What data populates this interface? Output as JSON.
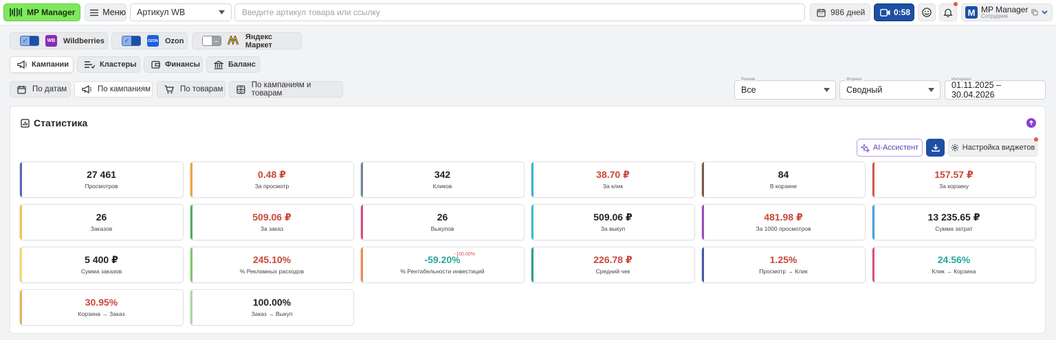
{
  "header": {
    "logo_text": "MP Manager",
    "menu_label": "Меню",
    "article_select": "Артикул WB",
    "search_placeholder": "Введите артикул товара или ссылку",
    "days_label": "986 дней",
    "timer_label": "0:58",
    "user_name": "MP Manager",
    "user_role": "Сотрудник",
    "avatar_letter": "M"
  },
  "marketplaces": [
    {
      "label": "Wildberries",
      "enabled": true,
      "logo": "WB",
      "color": "#8b2bb5"
    },
    {
      "label": "Ozon",
      "enabled": true,
      "logo": "OZON",
      "color": "#1e5fe0"
    },
    {
      "label": "Яндекс Маркет",
      "enabled": false,
      "logo": "YM",
      "color": "#f5c518"
    }
  ],
  "categories": [
    {
      "label": "Кампании",
      "icon": "megaphone-icon",
      "active": true
    },
    {
      "label": "Кластеры",
      "icon": "list-icon",
      "active": false
    },
    {
      "label": "Финансы",
      "icon": "wallet-icon",
      "active": false
    },
    {
      "label": "Баланс",
      "icon": "bank-icon",
      "active": false
    }
  ],
  "views": [
    {
      "label": "По датам",
      "icon": "calendar-icon",
      "active": false
    },
    {
      "label": "По кампаниям",
      "icon": "megaphone-icon",
      "active": true
    },
    {
      "label": "По товарам",
      "icon": "cart-icon",
      "active": false
    },
    {
      "label": "По кампаниям и товарам",
      "icon": "grid-icon",
      "active": false
    }
  ],
  "filters": {
    "mode_label": "Режим",
    "mode_value": "Все",
    "format_label": "Формат",
    "format_value": "Сводный",
    "interval_label": "Интервал",
    "interval_value": "01.11.2025 – 30.04.2026"
  },
  "stats": {
    "title": "Статистика",
    "ai_label": "AI-Ассистент",
    "settings_label": "Настройка виджетов",
    "cards": [
      {
        "value": "27 461",
        "caption": "Просмотров",
        "bar": "#5a67b8",
        "tone": "dark"
      },
      {
        "value": "0.48 ₽",
        "caption": "За просмотр",
        "bar": "#f0a33c",
        "tone": "red"
      },
      {
        "value": "342",
        "caption": "Кликов",
        "bar": "#6f8496",
        "tone": "dark"
      },
      {
        "value": "38.70 ₽",
        "caption": "За клик",
        "bar": "#3ab3d6",
        "tone": "red"
      },
      {
        "value": "84",
        "caption": "В корзине",
        "bar": "#7a5a48",
        "tone": "dark"
      },
      {
        "value": "157.57 ₽",
        "caption": "За корзину",
        "bar": "#d9564e",
        "tone": "red"
      },
      {
        "value": "26",
        "caption": "Заказов",
        "bar": "#f0c84a",
        "tone": "dark"
      },
      {
        "value": "509.06 ₽",
        "caption": "За заказ",
        "bar": "#4fae5c",
        "tone": "red"
      },
      {
        "value": "26",
        "caption": "Выкупов",
        "bar": "#d94a86",
        "tone": "dark"
      },
      {
        "value": "509.06 ₽",
        "caption": "За выкуп",
        "bar": "#3bbfc8",
        "tone": "dark"
      },
      {
        "value": "481.98 ₽",
        "caption": "За 1000 просмотров",
        "bar": "#9b4cc0",
        "tone": "red"
      },
      {
        "value": "13 235.65 ₽",
        "caption": "Сумма затрат",
        "bar": "#3fa4dc",
        "tone": "dark"
      },
      {
        "value": "5 400 ₽",
        "caption": "Сумма заказов",
        "bar": "#f5d96b",
        "tone": "dark"
      },
      {
        "value": "245.10%",
        "caption": "% Рекламных расходов",
        "bar": "#7ec96a",
        "tone": "red"
      },
      {
        "value": "-59.20%",
        "caption": "% Рентабельности инвестиций",
        "bar": "#f08a4b",
        "tone": "green",
        "sup": "-100.00%"
      },
      {
        "value": "226.78 ₽",
        "caption": "Средний чек",
        "bar": "#2f9e8f",
        "tone": "red"
      },
      {
        "value": "1.25%",
        "caption": "Просмотр → Клик",
        "bar": "#4658a8",
        "tone": "red"
      },
      {
        "value": "24.56%",
        "caption": "Клик → Корзина",
        "bar": "#e0507f",
        "tone": "green"
      },
      {
        "value": "30.95%",
        "caption": "Корзина → Заказ",
        "bar": "#e3b45a",
        "tone": "red"
      },
      {
        "value": "100.00%",
        "caption": "Заказ → Выкуп",
        "bar": "#a8dca0",
        "tone": "dark"
      }
    ]
  }
}
